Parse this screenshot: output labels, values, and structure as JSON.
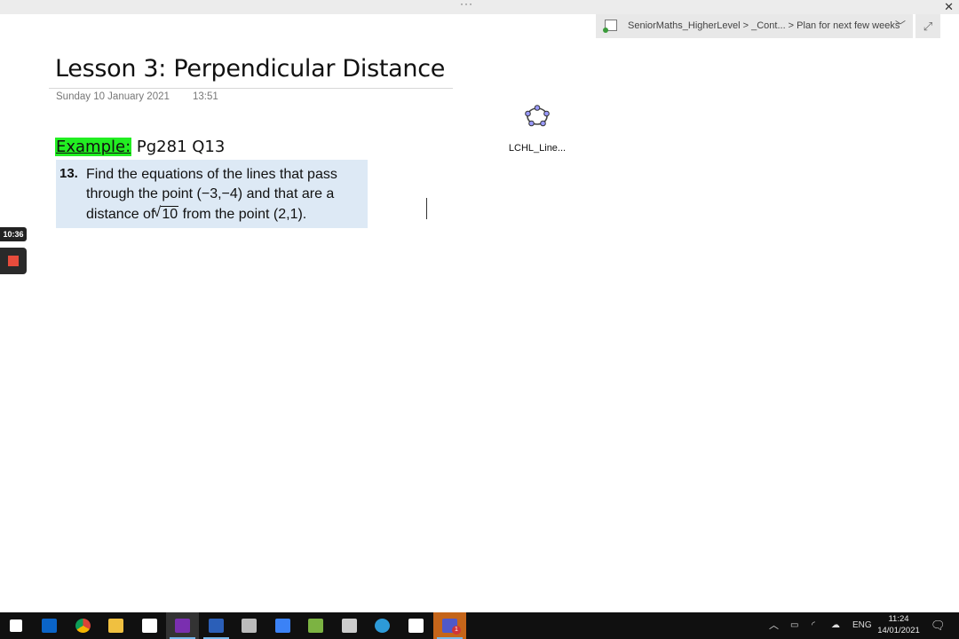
{
  "window": {
    "dots": "···",
    "close": "✕"
  },
  "breadcrumb": {
    "text": "SeniorMaths_HigherLevel >  _Cont...   >  Plan for next few weeks"
  },
  "page": {
    "title": "Lesson 3: Perpendicular Distance",
    "date": "Sunday 10 January 2021",
    "time": "13:51"
  },
  "example": {
    "label": "Example:",
    "ref": "Pg281 Q13"
  },
  "problem": {
    "number": "13.",
    "line1": "Find the equations of the lines that pass",
    "line2": "through the point (−3,−4) and that are a",
    "line3_pre": "distance  of",
    "radicand": "10",
    "line3_post": " from the point (2,1)."
  },
  "attachment": {
    "name": "LCHL_Line..."
  },
  "recorder": {
    "time": "10:36"
  },
  "taskbar": {
    "apps": [
      {
        "icon": "windows-start-icon",
        "color": "#ffffff"
      },
      {
        "icon": "outlook-icon",
        "color": "#0a64c8"
      },
      {
        "icon": "chrome-icon",
        "color": "#e0b020"
      },
      {
        "icon": "file-explorer-icon",
        "color": "#f0c040"
      },
      {
        "icon": "snipping-tool-icon",
        "color": "#ffffff"
      },
      {
        "icon": "onenote-icon",
        "color": "#7a2fb0"
      },
      {
        "icon": "word-icon",
        "color": "#2b5fb8"
      },
      {
        "icon": "printer-icon",
        "color": "#bbbbbb"
      },
      {
        "icon": "todo-icon",
        "color": "#3b82f6"
      },
      {
        "icon": "calculator-icon",
        "color": "#7cb342"
      },
      {
        "icon": "phone-link-icon",
        "color": "#cccccc"
      },
      {
        "icon": "edge-icon",
        "color": "#2d9ad8"
      },
      {
        "icon": "whiteboard-icon",
        "color": "#ffffff"
      },
      {
        "icon": "teams-icon",
        "color": "#5059c9"
      }
    ],
    "teams_badge": "1",
    "tray": {
      "language": "ENG",
      "time": "11:24",
      "date": "14/01/2021"
    }
  }
}
